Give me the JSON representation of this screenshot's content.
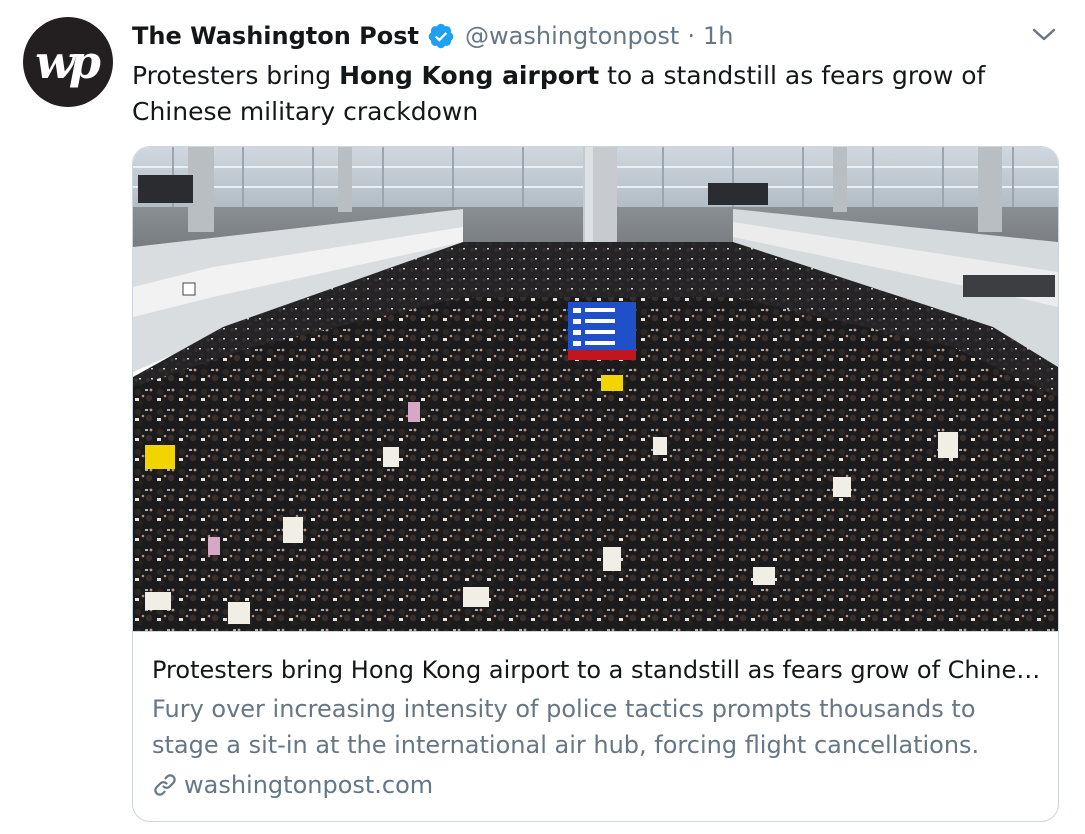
{
  "author": {
    "name": "The Washington Post",
    "handle": "@washingtonpost",
    "separator": "·",
    "time": "1h",
    "avatar_text": "wp"
  },
  "tweet": {
    "text_before": "Protesters bring ",
    "text_bold": "Hong Kong airport",
    "text_after": " to a standstill as fears grow of Chinese military crackdown"
  },
  "card": {
    "title": "Protesters bring Hong Kong airport to a standstill as fears grow of Chinese military crackdown",
    "description": "Fury over increasing intensity of police tactics prompts thousands to stage a sit-in at the international air hub, forcing flight cancellations.",
    "domain": "washingtonpost.com"
  },
  "colors": {
    "text": "#14171a",
    "secondary": "#657786",
    "border": "#ccd6dd",
    "verified": "#1da1f2",
    "avatar_bg": "#231f20"
  },
  "icons": [
    "verified-badge-icon",
    "caret-down-icon",
    "link-icon"
  ]
}
